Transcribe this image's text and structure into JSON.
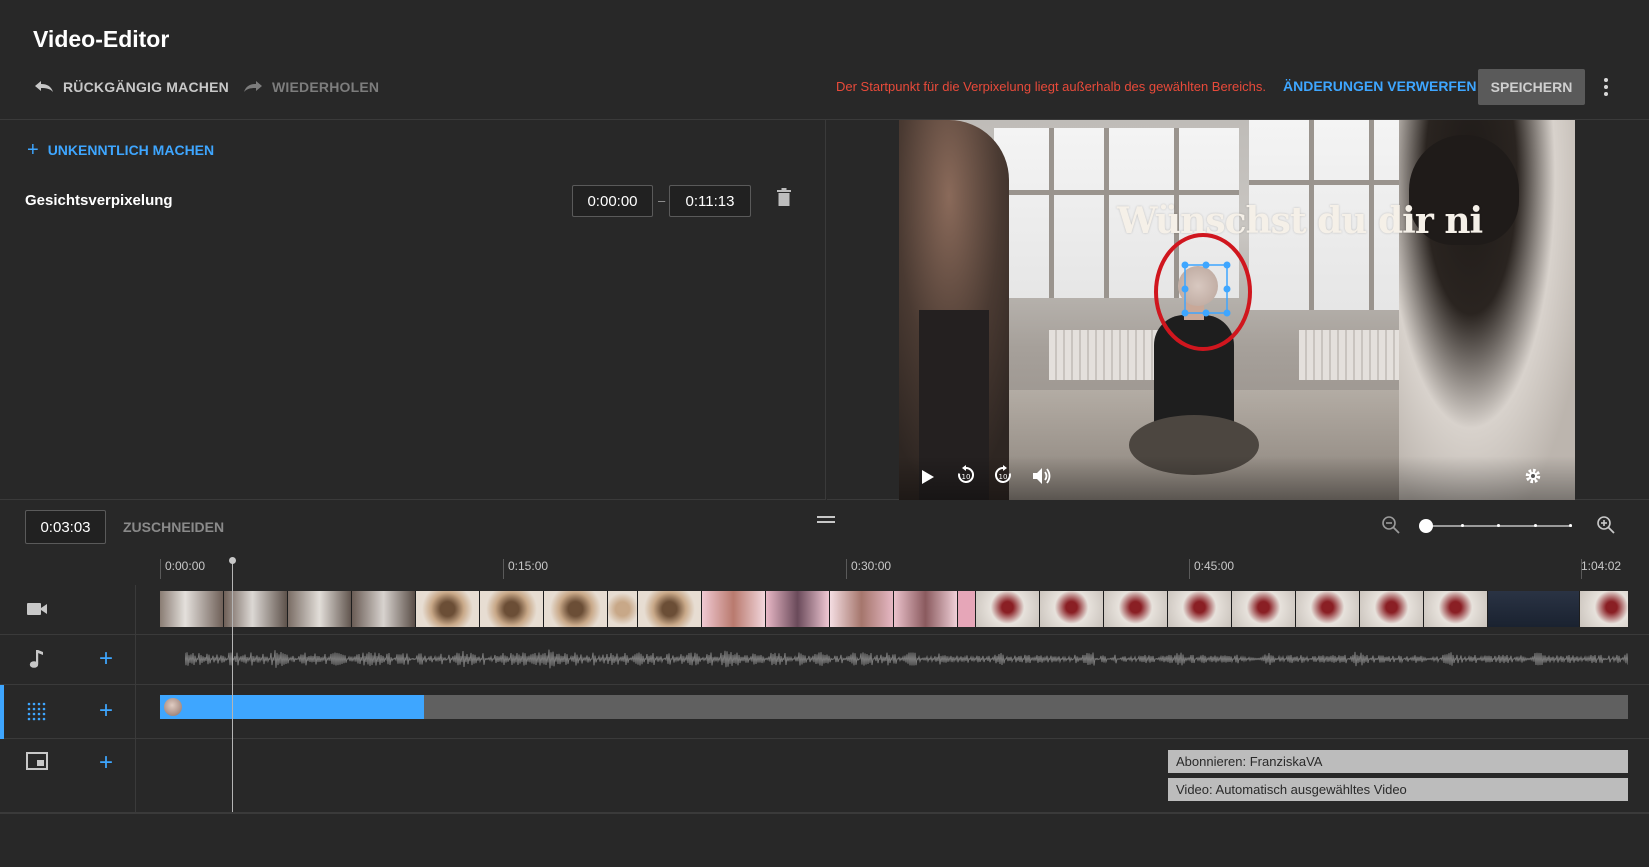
{
  "header": {
    "title": "Video-Editor",
    "undo_label": "RÜCKGÄNGIG MACHEN",
    "redo_label": "WIEDERHOLEN",
    "warning": "Der Startpunkt für die Verpixelung liegt außerhalb des gewählten Bereichs.",
    "discard_label": "ÄNDERUNGEN VERWERFEN",
    "save_label": "SPEICHERN"
  },
  "blur_panel": {
    "add_label": "UNKENNTLICH MACHEN",
    "effect": {
      "label": "Gesichtsverpixelung",
      "start": "0:00:00",
      "end": "0:11:13"
    }
  },
  "preview": {
    "caption": "Wünschst du dir ni",
    "highlight_color": "#d0161e",
    "handle_color": "#3ea6ff"
  },
  "timeline": {
    "current_time": "0:03:03",
    "trim_label": "ZUSCHNEIDEN",
    "zoom_level": 0,
    "ruler": [
      "0:00:00",
      "0:15:00",
      "0:30:00",
      "0:45:00",
      "1:04:02"
    ],
    "blur_segment_fraction": 0.18,
    "endscreen": [
      "Abonnieren: FranziskaVA",
      "Video: Automatisch ausgewähltes Video"
    ]
  },
  "colors": {
    "accent": "#3ea6ff",
    "warning": "#e84a3a",
    "background": "#282828"
  },
  "icons": {
    "undo": "undo-icon",
    "redo": "redo-icon",
    "more": "more-vert-icon",
    "add": "plus-icon",
    "delete": "trash-icon",
    "play": "play-icon",
    "replay10": "replay-10-icon",
    "forward10": "forward-10-icon",
    "volume": "volume-icon",
    "settings": "gear-icon",
    "zoom_out": "zoom-out-icon",
    "zoom_in": "zoom-in-icon",
    "video_track": "videocam-icon",
    "audio_track": "music-note-icon",
    "blur_track": "blur-icon",
    "endscreen_track": "end-screen-icon"
  }
}
